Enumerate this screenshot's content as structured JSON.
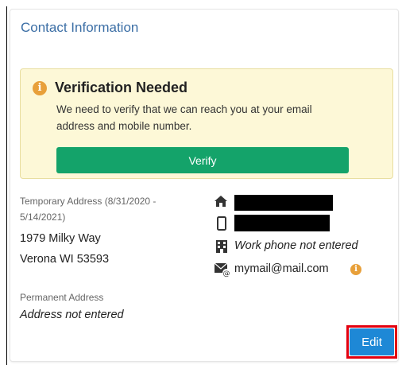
{
  "card": {
    "title": "Contact Information"
  },
  "alert": {
    "title": "Verification Needed",
    "message": "We need to verify that we can reach you at your email address and mobile number.",
    "verify_label": "Verify",
    "icon": "info-circle-icon",
    "color": "#e8a03a"
  },
  "temporary_address": {
    "label": "Temporary Address (8/31/2020 - 5/14/2021)",
    "line1": "1979 Milky Way",
    "line2": "Verona WI 53593"
  },
  "permanent_address": {
    "label": "Permanent Address",
    "value": "Address not entered"
  },
  "contacts": {
    "home_phone_icon": "home-icon",
    "mobile_phone_icon": "mobile-phone-icon",
    "work_phone": "Work phone not entered",
    "work_phone_icon": "building-icon",
    "email": "mymail@mail.com",
    "email_icon": "email-icon"
  },
  "edit_label": "Edit",
  "colors": {
    "accent": "#1e88d6",
    "verify": "#14a36a",
    "title": "#3b6ea5",
    "highlight": "#e3000f"
  }
}
